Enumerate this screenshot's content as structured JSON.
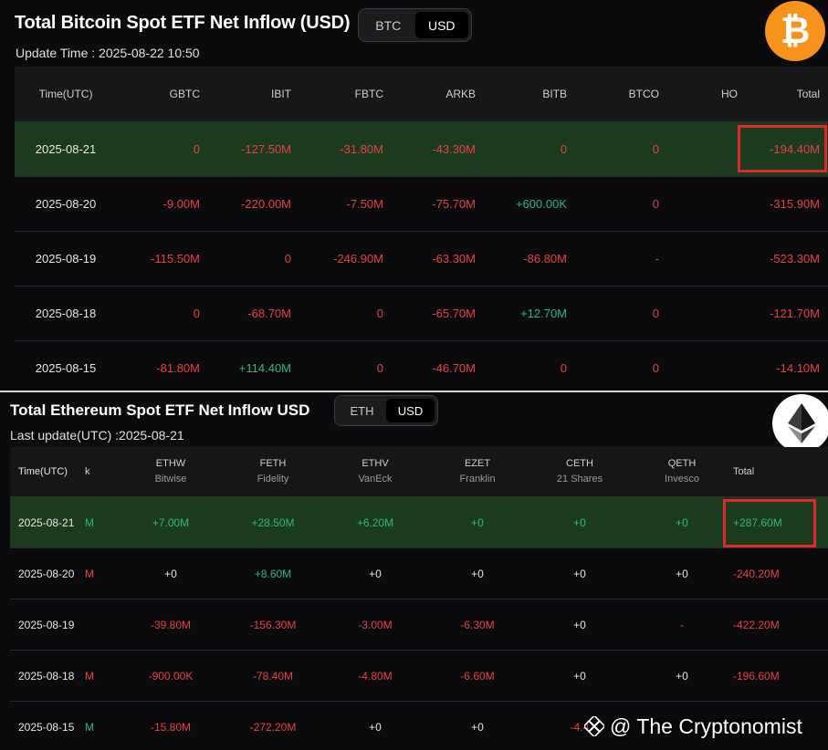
{
  "btc": {
    "title": "Total Bitcoin Spot ETF Net Inflow (USD)",
    "toggle": [
      "BTC",
      "USD"
    ],
    "toggle_active": "USD",
    "update_time": "Update Time : 2025-08-22 10:50",
    "logo_glyph": "₿",
    "logo_color": "#f7931a",
    "columns": [
      "Time(UTC)",
      "GBTC",
      "IBIT",
      "FBTC",
      "ARKB",
      "BITB",
      "BTCO",
      "HO",
      "Total"
    ],
    "rows": [
      {
        "time": "2025-08-21",
        "gbtc": "0",
        "ibit": "-127.50M",
        "fbtc": "-31.80M",
        "arkb": "-43.30M",
        "bitb": "0",
        "btco": "0",
        "total": "-194.40M",
        "highlight": true
      },
      {
        "time": "2025-08-20",
        "gbtc": "-9.00M",
        "ibit": "-220.00M",
        "fbtc": "-7.50M",
        "arkb": "-75.70M",
        "bitb": "+600.00K",
        "btco": "0",
        "total": "-315.90M"
      },
      {
        "time": "2025-08-19",
        "gbtc": "-115.50M",
        "ibit": "0",
        "fbtc": "-246.90M",
        "arkb": "-63.30M",
        "bitb": "-86.80M",
        "btco": "-",
        "total": "-523.30M"
      },
      {
        "time": "2025-08-18",
        "gbtc": "0",
        "ibit": "-68.70M",
        "fbtc": "0",
        "arkb": "-65.70M",
        "bitb": "+12.70M",
        "btco": "0",
        "total": "-121.70M"
      },
      {
        "time": "2025-08-15",
        "gbtc": "-81.80M",
        "ibit": "+114.40M",
        "fbtc": "0",
        "arkb": "-46.70M",
        "bitb": "0",
        "btco": "0",
        "total": "-14.10M"
      }
    ]
  },
  "eth": {
    "title": "Total Ethereum Spot ETF Net Inflow USD",
    "toggle": [
      "ETH",
      "USD"
    ],
    "toggle_active": "USD",
    "update_time": "Last update(UTC) :2025-08-21",
    "columns": [
      {
        "name": "Time(UTC)"
      },
      {
        "name": "k"
      },
      {
        "name": "ETHW",
        "sub": "Bitwise"
      },
      {
        "name": "FETH",
        "sub": "Fidelity"
      },
      {
        "name": "ETHV",
        "sub": "VanEck"
      },
      {
        "name": "EZET",
        "sub": "Franklin"
      },
      {
        "name": "CETH",
        "sub": "21 Shares"
      },
      {
        "name": "QETH",
        "sub": "Invesco"
      },
      {
        "name": "Total"
      }
    ],
    "rows": [
      {
        "time": "2025-08-21",
        "k": "M",
        "ethw": "+7.00M",
        "feth": "+28.50M",
        "ethv": "+6.20M",
        "ezet": "+0",
        "ceth": "+0",
        "qeth": "+0",
        "total": "+287.60M",
        "highlight": true
      },
      {
        "time": "2025-08-20",
        "k": "M",
        "ethw": "+0",
        "feth": "+8.60M",
        "ethv": "+0",
        "ezet": "+0",
        "ceth": "+0",
        "qeth": "+0",
        "total": "-240.20M"
      },
      {
        "time": "2025-08-19",
        "k": "",
        "ethw": "-39.80M",
        "feth": "-156.30M",
        "ethv": "-3.00M",
        "ezet": "-6.30M",
        "ceth": "+0",
        "qeth": "-",
        "total": "-422.20M"
      },
      {
        "time": "2025-08-18",
        "k": "M",
        "ethw": "-900.00K",
        "feth": "-78.40M",
        "ethv": "-4.80M",
        "ezet": "-6.60M",
        "ceth": "+0",
        "qeth": "+0",
        "total": "-196.60M"
      },
      {
        "time": "2025-08-15",
        "k": "M",
        "ethw": "-15.80M",
        "feth": "-272.20M",
        "ethv": "+0",
        "ezet": "+0",
        "ceth": "-4.4",
        "qeth": "",
        "total": ""
      }
    ]
  },
  "watermark": "@ The Cryptonomist",
  "colors": {
    "negative": "#e84142",
    "positive": "#2eb97b",
    "highlight_row": "#1c3a1d",
    "highlight_box": "#e0282a"
  }
}
